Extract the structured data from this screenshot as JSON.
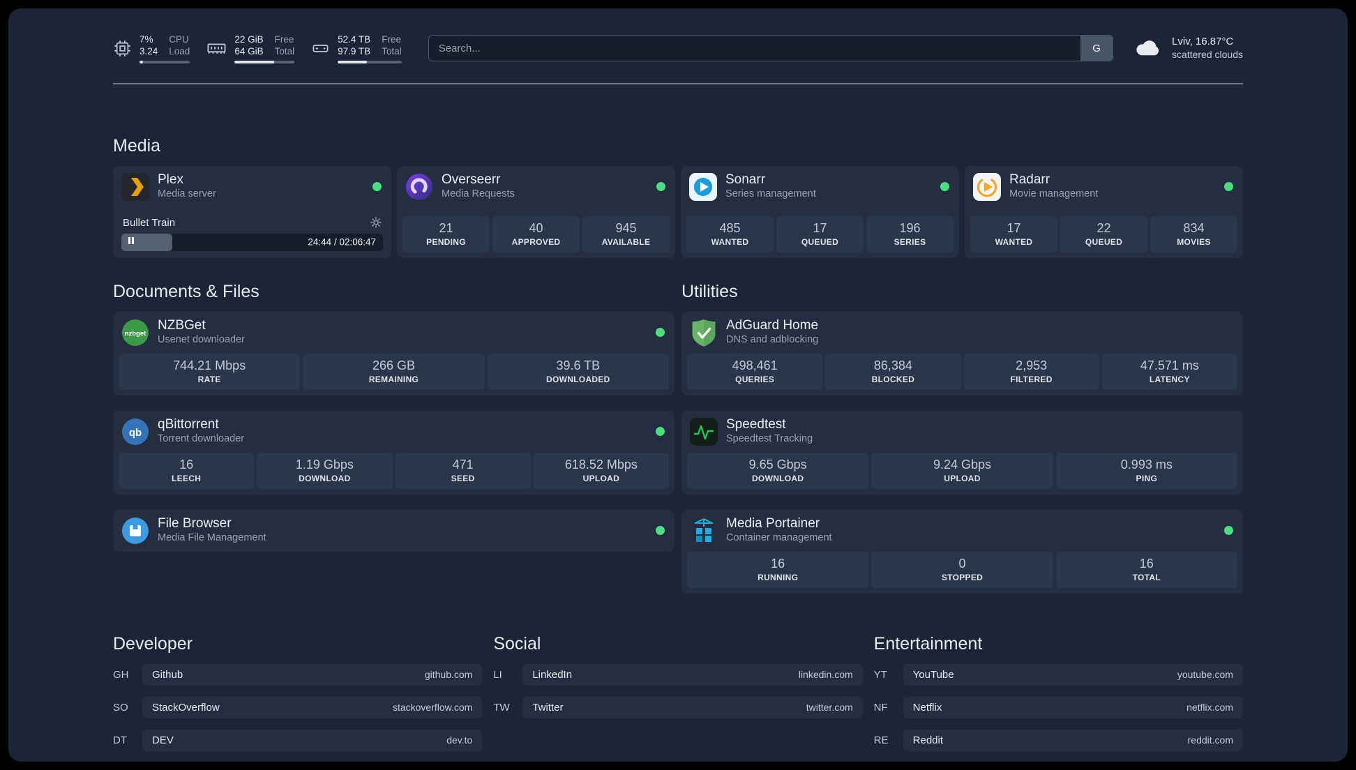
{
  "theme": {
    "status_online": "#4ade80",
    "plex_accent": "#e5a00d",
    "background": "#1c2536"
  },
  "topbar": {
    "resources": [
      {
        "line1_value": "7%",
        "line2_value": "3.24",
        "line1_label": "CPU",
        "line2_label": "Load",
        "progress_pct": 7
      },
      {
        "line1_value": "22 GiB",
        "line2_value": "64 GiB",
        "line1_label": "Free",
        "line2_label": "Total",
        "progress_pct": 66
      },
      {
        "line1_value": "52.4 TB",
        "line2_value": "97.9 TB",
        "line1_label": "Free",
        "line2_label": "Total",
        "progress_pct": 46
      }
    ],
    "search": {
      "placeholder": "Search...",
      "engine_button": "G"
    },
    "weather": {
      "location": "Lviv, 16.87°C",
      "condition": "scattered clouds"
    }
  },
  "sections": {
    "media": {
      "title": "Media"
    },
    "documents": {
      "title": "Documents & Files"
    },
    "utilities": {
      "title": "Utilities"
    }
  },
  "services": {
    "plex": {
      "name": "Plex",
      "desc": "Media server",
      "now_playing": "Bullet Train",
      "time": "24:44 / 02:06:47",
      "progress_pct": 19.5
    },
    "overseerr": {
      "name": "Overseerr",
      "desc": "Media Requests",
      "stats": [
        {
          "value": "21",
          "label": "PENDING"
        },
        {
          "value": "40",
          "label": "APPROVED"
        },
        {
          "value": "945",
          "label": "AVAILABLE"
        }
      ]
    },
    "sonarr": {
      "name": "Sonarr",
      "desc": "Series management",
      "stats": [
        {
          "value": "485",
          "label": "WANTED"
        },
        {
          "value": "17",
          "label": "QUEUED"
        },
        {
          "value": "196",
          "label": "SERIES"
        }
      ]
    },
    "radarr": {
      "name": "Radarr",
      "desc": "Movie management",
      "stats": [
        {
          "value": "17",
          "label": "WANTED"
        },
        {
          "value": "22",
          "label": "QUEUED"
        },
        {
          "value": "834",
          "label": "MOVIES"
        }
      ]
    },
    "nzbget": {
      "name": "NZBGet",
      "desc": "Usenet downloader",
      "stats": [
        {
          "value": "744.21 Mbps",
          "label": "RATE"
        },
        {
          "value": "266 GB",
          "label": "REMAINING"
        },
        {
          "value": "39.6 TB",
          "label": "DOWNLOADED"
        }
      ]
    },
    "qbittorrent": {
      "name": "qBittorrent",
      "desc": "Torrent downloader",
      "stats": [
        {
          "value": "16",
          "label": "LEECH"
        },
        {
          "value": "1.19 Gbps",
          "label": "DOWNLOAD"
        },
        {
          "value": "471",
          "label": "SEED"
        },
        {
          "value": "618.52 Mbps",
          "label": "UPLOAD"
        }
      ]
    },
    "filebrowser": {
      "name": "File Browser",
      "desc": "Media File Management"
    },
    "adguard": {
      "name": "AdGuard Home",
      "desc": "DNS and adblocking",
      "stats": [
        {
          "value": "498,461",
          "label": "QUERIES"
        },
        {
          "value": "86,384",
          "label": "BLOCKED"
        },
        {
          "value": "2,953",
          "label": "FILTERED"
        },
        {
          "value": "47.571 ms",
          "label": "LATENCY"
        }
      ]
    },
    "speedtest": {
      "name": "Speedtest",
      "desc": "Speedtest Tracking",
      "stats": [
        {
          "value": "9.65 Gbps",
          "label": "DOWNLOAD"
        },
        {
          "value": "9.24 Gbps",
          "label": "UPLOAD"
        },
        {
          "value": "0.993 ms",
          "label": "PING"
        }
      ]
    },
    "portainer": {
      "name": "Media Portainer",
      "desc": "Container management",
      "stats": [
        {
          "value": "16",
          "label": "RUNNING"
        },
        {
          "value": "0",
          "label": "STOPPED"
        },
        {
          "value": "16",
          "label": "TOTAL"
        }
      ]
    }
  },
  "bookmarks": [
    {
      "title": "Developer",
      "items": [
        {
          "abbr": "GH",
          "name": "Github",
          "domain": "github.com"
        },
        {
          "abbr": "SO",
          "name": "StackOverflow",
          "domain": "stackoverflow.com"
        },
        {
          "abbr": "DT",
          "name": "DEV",
          "domain": "dev.to"
        }
      ]
    },
    {
      "title": "Social",
      "items": [
        {
          "abbr": "LI",
          "name": "LinkedIn",
          "domain": "linkedin.com"
        },
        {
          "abbr": "TW",
          "name": "Twitter",
          "domain": "twitter.com"
        }
      ]
    },
    {
      "title": "Entertainment",
      "items": [
        {
          "abbr": "YT",
          "name": "YouTube",
          "domain": "youtube.com"
        },
        {
          "abbr": "NF",
          "name": "Netflix",
          "domain": "netflix.com"
        },
        {
          "abbr": "RE",
          "name": "Reddit",
          "domain": "reddit.com"
        }
      ]
    }
  ]
}
